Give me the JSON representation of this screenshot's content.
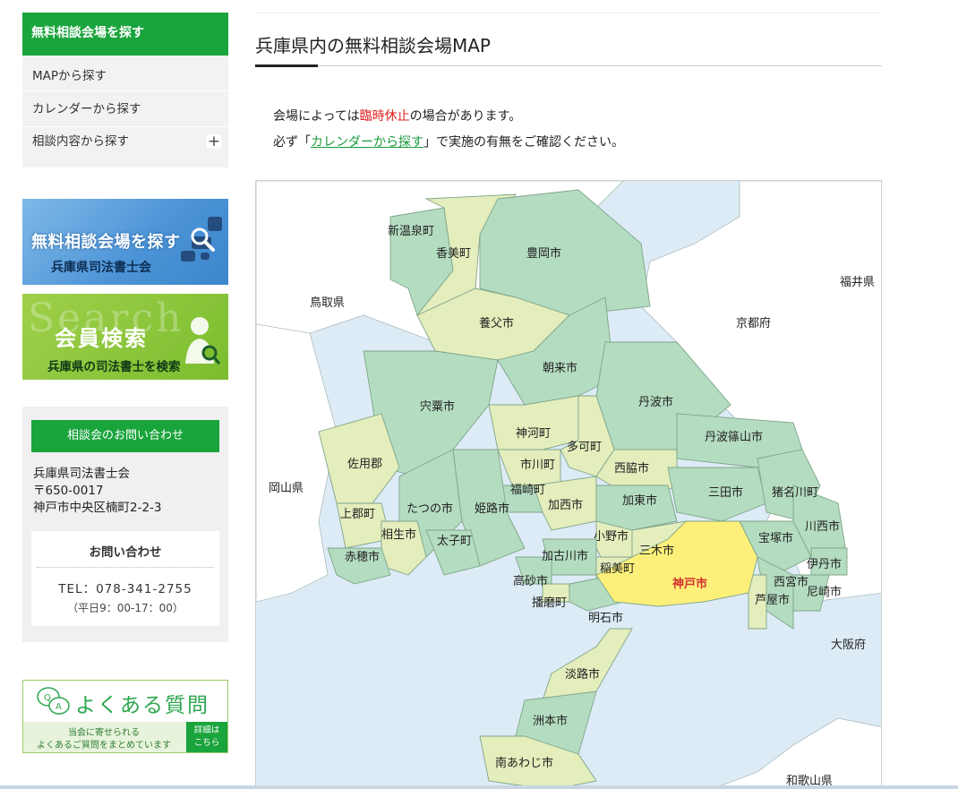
{
  "sidebar": {
    "menu_title": "無料相談会場を探す",
    "menu_items": [
      {
        "label": "MAPから探す"
      },
      {
        "label": "カレンダーから探す"
      },
      {
        "label": "相談内容から探す",
        "expand": "+"
      }
    ],
    "banner_search": {
      "main": "無料相談会場を探す",
      "sub": "兵庫県司法書士会"
    },
    "banner_member": {
      "ghost": "Search",
      "main": "会員検索",
      "sub": "兵庫県の司法書士を検索"
    },
    "contact": {
      "heading": "相談会のお問い合わせ",
      "org": "兵庫県司法書士会",
      "postal": "〒650-0017",
      "address": "神戸市中央区楠町2-2-3",
      "inquiry_title": "お問い合わせ",
      "tel": "TEL：078-341-2755",
      "hours": "（平日9：00-17：00）"
    },
    "faq": {
      "title": "よくある質問",
      "sub1": "当会に寄せられる",
      "sub2": "よくあるご質問をまとめています",
      "detail1": "詳細は",
      "detail2": "こちら"
    }
  },
  "main": {
    "title": "兵庫県内の無料相談会場MAP",
    "notice": {
      "line1_pre": "会場によっては",
      "line1_red": "臨時休止",
      "line1_post": "の場合があります。",
      "line2_pre": "必ず「",
      "line2_link": "カレンダーから探す",
      "line2_post": "」で実施の有無をご確認ください。"
    }
  },
  "map": {
    "colors": {
      "sea": "#dcebf5",
      "land": "#ffffff",
      "green": "#b4dcc0",
      "light": "#e4edbc",
      "kobe": "#fdf07a",
      "kobe_label": "#d32f2f",
      "border": "#8aa88f"
    },
    "neighbors": [
      "鳥取県",
      "福井県",
      "京都府",
      "岡山県",
      "大阪府",
      "和歌山県"
    ],
    "municipalities": [
      "新温泉町",
      "香美町",
      "豊岡市",
      "養父市",
      "朝来市",
      "丹波市",
      "宍粟市",
      "神河町",
      "多可町",
      "丹波篠山市",
      "佐用郡",
      "市川町",
      "西脇市",
      "福崎町",
      "三田市",
      "猪名川町",
      "たつの市",
      "姫路市",
      "加西市",
      "加東市",
      "上郡町",
      "川西市",
      "宝塚市",
      "相生市",
      "太子町",
      "小野市",
      "三木市",
      "赤穂市",
      "加古川市",
      "伊丹市",
      "高砂市",
      "稲美町",
      "西宮市",
      "尼崎市",
      "播磨町",
      "芦屋市",
      "明石市",
      "淡路市",
      "洲本市",
      "南あわじ市"
    ],
    "highlight": "神戸市"
  }
}
